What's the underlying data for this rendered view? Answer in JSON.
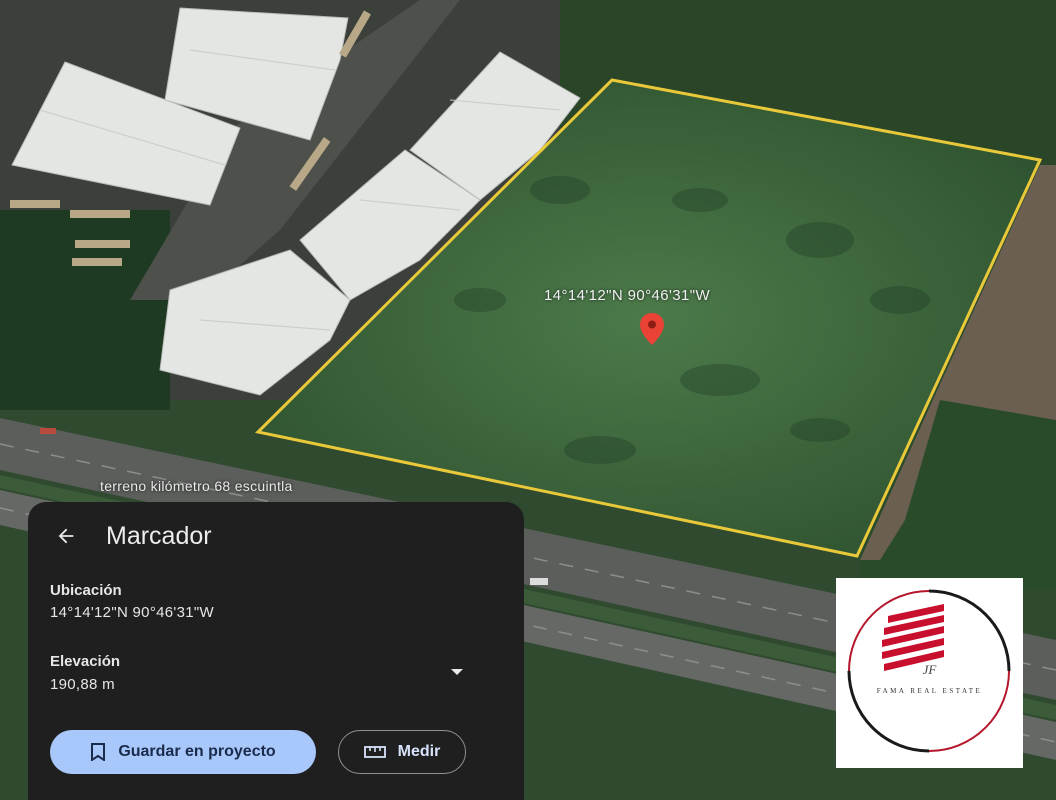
{
  "map": {
    "coordinates_label": "14°14'12\"N 90°46'31\"W",
    "place_label": "terreno kilómetro 68 escuintla",
    "colors": {
      "boundary": "#e9c93a",
      "pin": "#ea4335"
    }
  },
  "panel": {
    "title": "Marcador",
    "location_label": "Ubicación",
    "location_value": "14°14'12\"N 90°46'31\"W",
    "elevation_label": "Elevación",
    "elevation_value": "190,88 m",
    "save_button": "Guardar en proyecto",
    "measure_button": "Medir",
    "icons": [
      "back-arrow-icon",
      "dropdown-icon",
      "bookmark-icon",
      "ruler-icon"
    ]
  },
  "watermark": {
    "brand": "FAMA REAL ESTATE",
    "monogram": "JF"
  }
}
